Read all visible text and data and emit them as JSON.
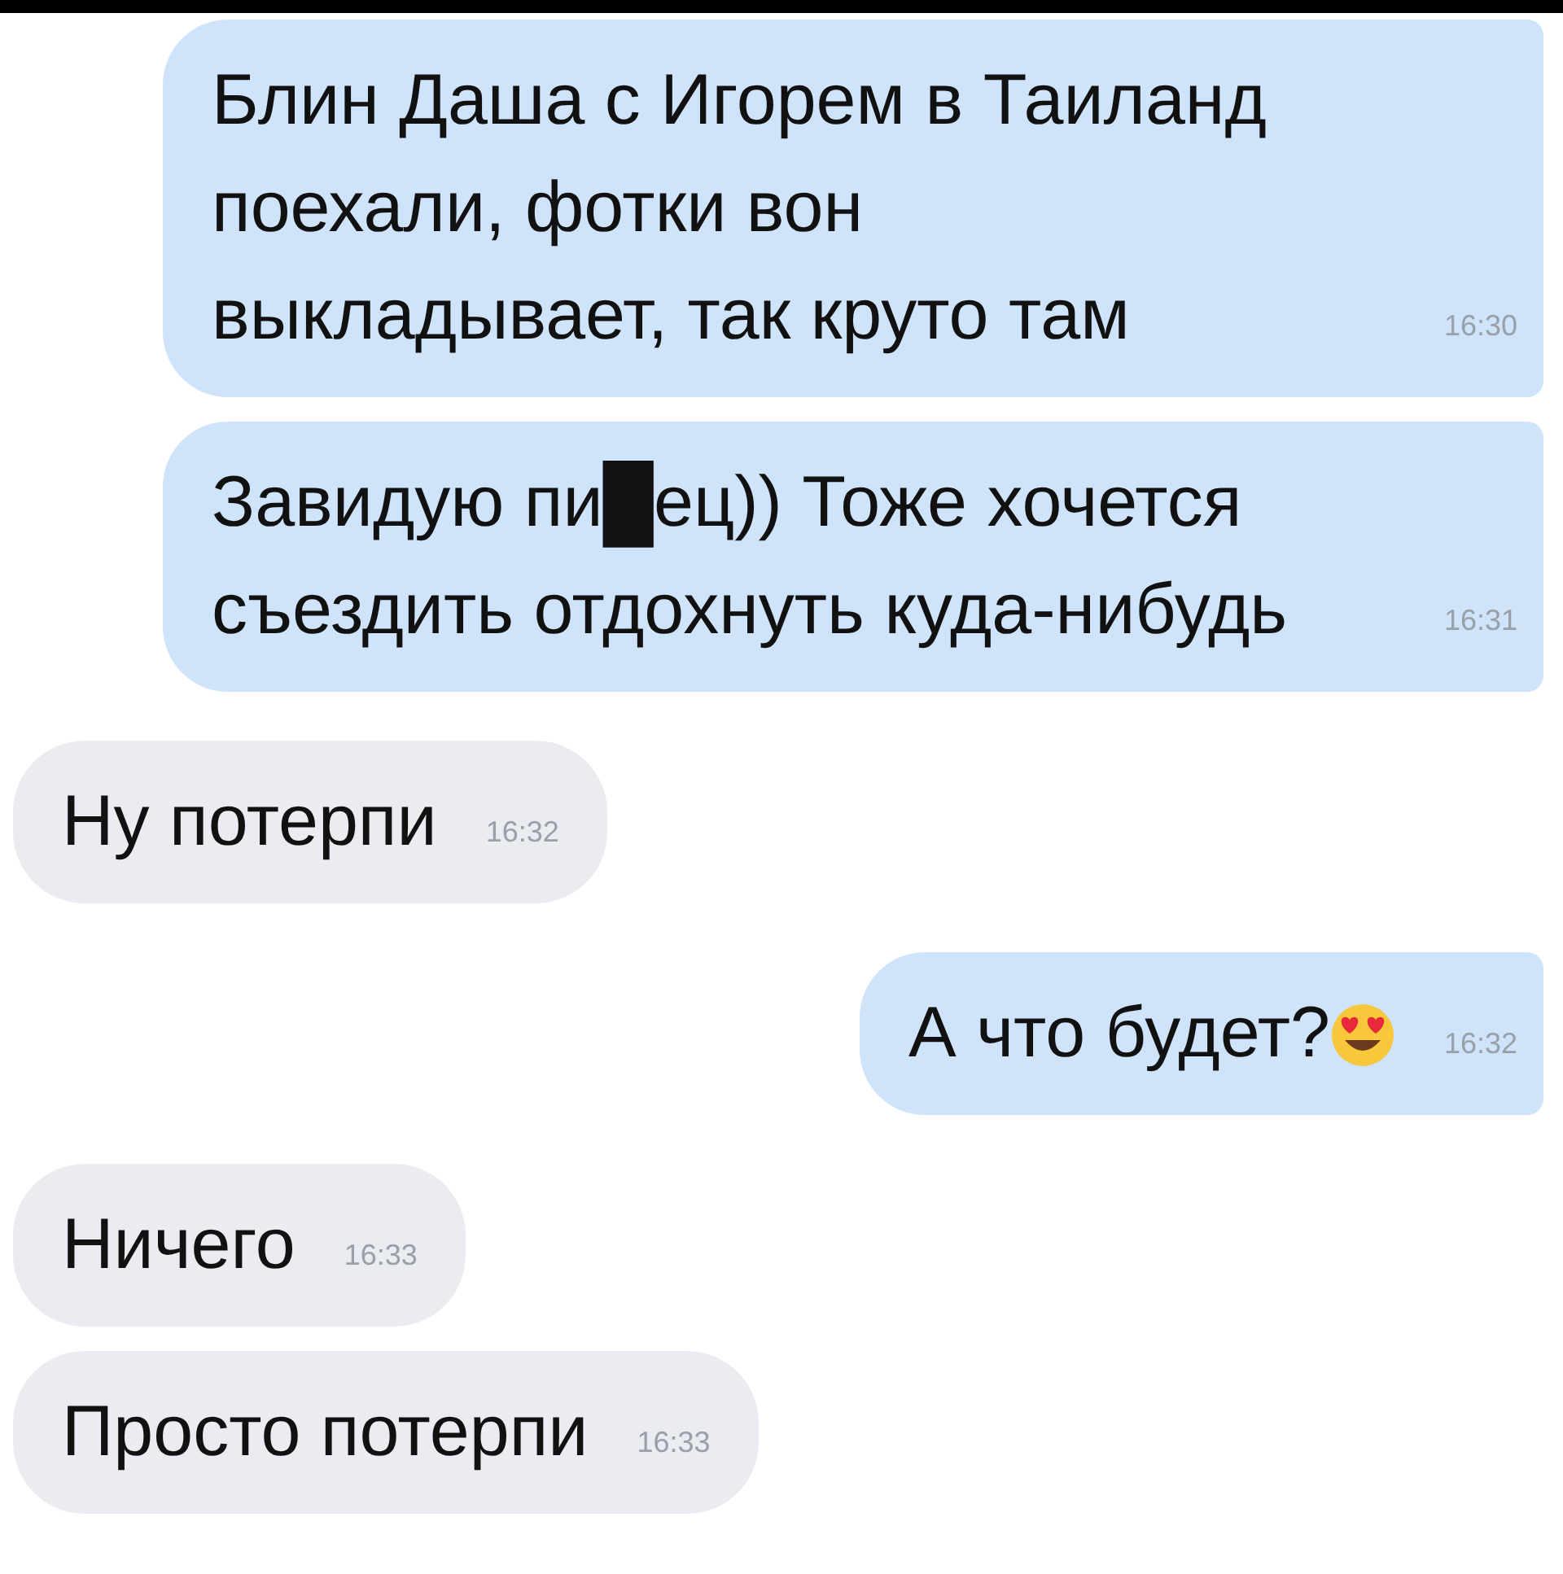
{
  "messages": [
    {
      "kind": "outgoing",
      "text": "Блин Даша с Игорем в Таиланд поехали, фотки вон выкладывает, так круто там",
      "time": "16:30"
    },
    {
      "kind": "outgoing",
      "text": "Завидую пи█ец)) Тоже хочется съездить отдохнуть куда-нибудь",
      "time": "16:31"
    },
    {
      "kind": "incoming",
      "text": "Ну потерпи",
      "time": "16:32"
    },
    {
      "kind": "outgoing",
      "text": "А что будет?",
      "emoji": {
        "kind": "heart-eyes"
      },
      "time": "16:32"
    },
    {
      "kind": "incoming",
      "text": "Ничего",
      "time": "16:33"
    },
    {
      "kind": "incoming",
      "text": "Просто потерпи",
      "time": "16:33"
    }
  ]
}
